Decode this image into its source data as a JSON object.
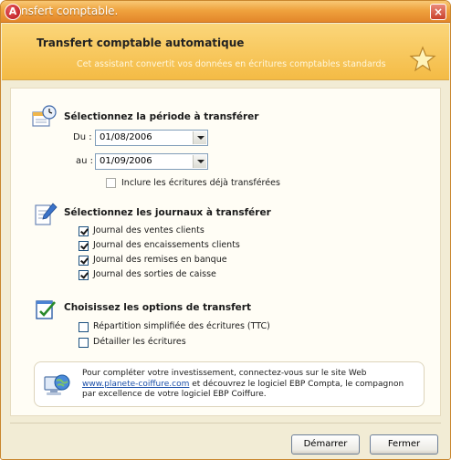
{
  "titlebar": {
    "badge": "A",
    "title": "nsfert comptable.",
    "close": "×"
  },
  "header": {
    "title": "Transfert comptable automatique",
    "subtitle": "Cet assistant convertit vos données en écritures comptables standards"
  },
  "period": {
    "title": "Sélectionnez la période à transférer",
    "from_label": "Du :",
    "from_value": "01/08/2006",
    "to_label": "au :",
    "to_value": "01/09/2006",
    "include_label": "Inclure les écritures déjà transférées",
    "include_checked": false
  },
  "journals": {
    "title": "Sélectionnez les journaux à transférer",
    "items": [
      {
        "label": "Journal des ventes clients",
        "checked": true
      },
      {
        "label": "Journal des encaissements clients",
        "checked": true
      },
      {
        "label": "Journal des remises en banque",
        "checked": true
      },
      {
        "label": "Journal des sorties de caisse",
        "checked": true
      }
    ]
  },
  "options": {
    "title": "Choisissez les options de transfert",
    "items": [
      {
        "label": "Répartition simplifiée des écritures (TTC)",
        "checked": false
      },
      {
        "label": "Détailler les écritures",
        "checked": false
      }
    ]
  },
  "info": {
    "line1": "Pour compléter votre investissement, connectez-vous sur le site Web",
    "link": "www.planete-coiffure.com",
    "line2": " et découvrez le logiciel EBP Compta, le compagnon",
    "line3": "par excellence de votre logiciel EBP Coiffure."
  },
  "buttons": {
    "start": "Démarrer",
    "close": "Fermer"
  },
  "icons": {
    "period": "calendar-clock-icon",
    "journals": "notepad-pencil-icon",
    "options": "checklist-icon",
    "info": "globe-computer-icon",
    "header": "star-icon"
  },
  "colors": {
    "titlebar": "#e3862a",
    "header": "#f4bb45",
    "background": "#f2ecd5",
    "link": "#1a4ea8"
  }
}
